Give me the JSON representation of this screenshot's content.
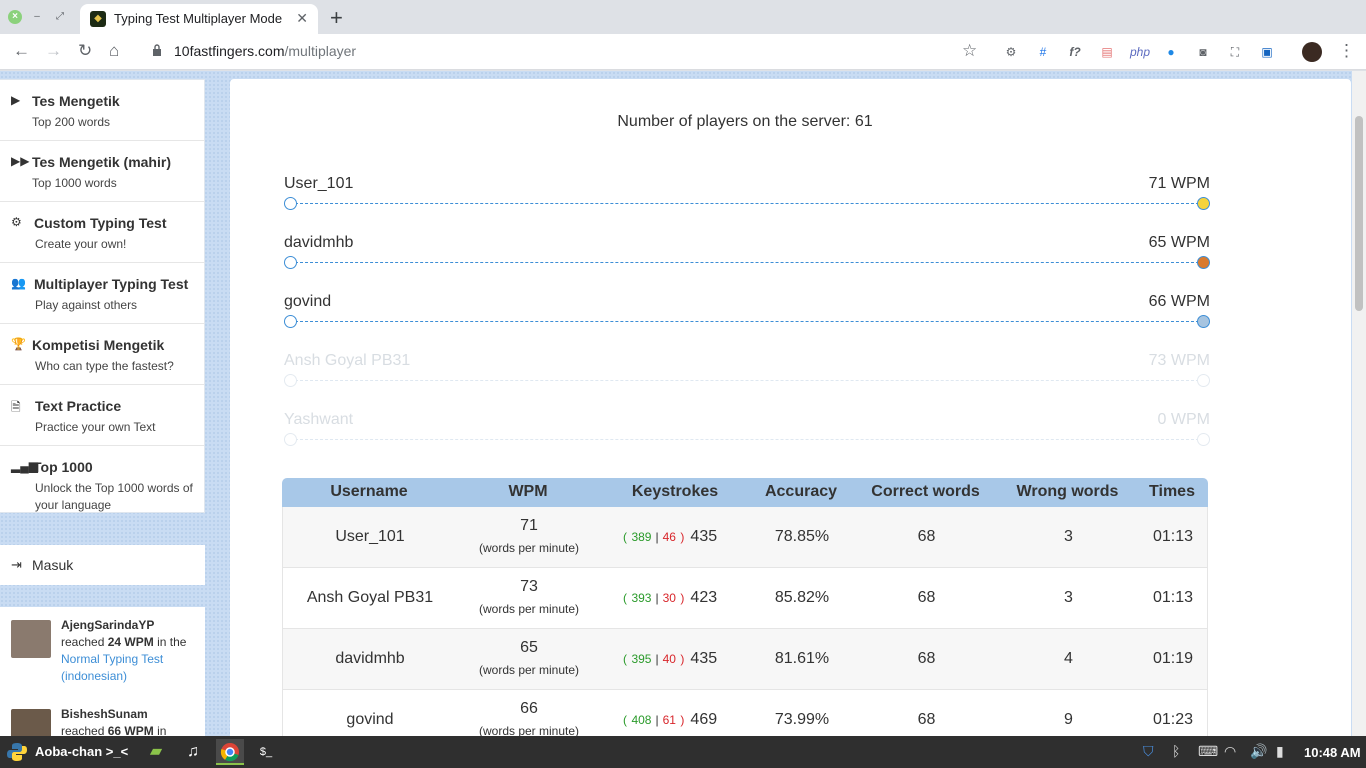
{
  "browser": {
    "tab_title": "Typing Test Multiplayer Mode",
    "url_domain": "10fastfingers.com",
    "url_path": "/multiplayer"
  },
  "sidebar": {
    "items": [
      {
        "icon": "play-icon",
        "title": "Tes Mengetik",
        "subtitle": "Top 200 words"
      },
      {
        "icon": "fast-forward-icon",
        "title": "Tes Mengetik (mahir)",
        "subtitle": "Top 1000 words"
      },
      {
        "icon": "gears-icon",
        "title": "Custom Typing Test",
        "subtitle": "Create your own!"
      },
      {
        "icon": "users-icon",
        "title": "Multiplayer Typing Test",
        "subtitle": "Play against others"
      },
      {
        "icon": "trophy-icon",
        "title": "Kompetisi Mengetik",
        "subtitle": "Who can type the fastest?"
      },
      {
        "icon": "document-icon",
        "title": "Text Practice",
        "subtitle": "Practice your own Text"
      },
      {
        "icon": "signal-bars-icon",
        "title": "Top 1000",
        "subtitle": "Unlock the Top 1000 words of your language"
      }
    ],
    "login_label": "Masuk"
  },
  "feed": [
    {
      "user": "AjengSarindaYP",
      "pre": "reached",
      "wpm": "24 WPM",
      "mid": "in the",
      "link": "Normal Typing Test (indonesian)"
    },
    {
      "user": "BisheshSunam",
      "pre": "reached",
      "wpm": "66 WPM",
      "mid": "in"
    }
  ],
  "server": {
    "players_text": "Number of players on the server: 61"
  },
  "race": [
    {
      "name": "User_101",
      "wpm": "71 WPM",
      "dot_color": "#f5d33b",
      "faded": false
    },
    {
      "name": "davidmhb",
      "wpm": "65 WPM",
      "dot_color": "#d97a2e",
      "faded": false
    },
    {
      "name": "govind",
      "wpm": "66 WPM",
      "dot_color": "#a6c4e0",
      "faded": false
    },
    {
      "name": "Ansh Goyal PB31",
      "wpm": "73 WPM",
      "dot_color": "#ffffff",
      "faded": true
    },
    {
      "name": "Yashwant",
      "wpm": "0 WPM",
      "dot_color": "#ffffff",
      "faded": true
    }
  ],
  "results": {
    "headers": [
      "Username",
      "WPM",
      "Keystrokes",
      "Accuracy",
      "Correct words",
      "Wrong words",
      "Times"
    ],
    "wpm_unit": "(words per minute)",
    "rows": [
      {
        "user": "User_101",
        "wpm": "71",
        "ks_ok": "389",
        "ks_bad": "46",
        "ks_total": "435",
        "accuracy": "78.85%",
        "correct": "68",
        "wrong": "3",
        "time": "01:13"
      },
      {
        "user": "Ansh Goyal PB31",
        "wpm": "73",
        "ks_ok": "393",
        "ks_bad": "30",
        "ks_total": "423",
        "accuracy": "85.82%",
        "correct": "68",
        "wrong": "3",
        "time": "01:13"
      },
      {
        "user": "davidmhb",
        "wpm": "65",
        "ks_ok": "395",
        "ks_bad": "40",
        "ks_total": "435",
        "accuracy": "81.61%",
        "correct": "68",
        "wrong": "4",
        "time": "01:19"
      },
      {
        "user": "govind",
        "wpm": "66",
        "ks_ok": "408",
        "ks_bad": "61",
        "ks_total": "469",
        "accuracy": "73.99%",
        "correct": "68",
        "wrong": "9",
        "time": "01:23"
      }
    ]
  },
  "taskbar": {
    "label": "Aoba-chan >_<",
    "clock": "10:48 AM"
  }
}
